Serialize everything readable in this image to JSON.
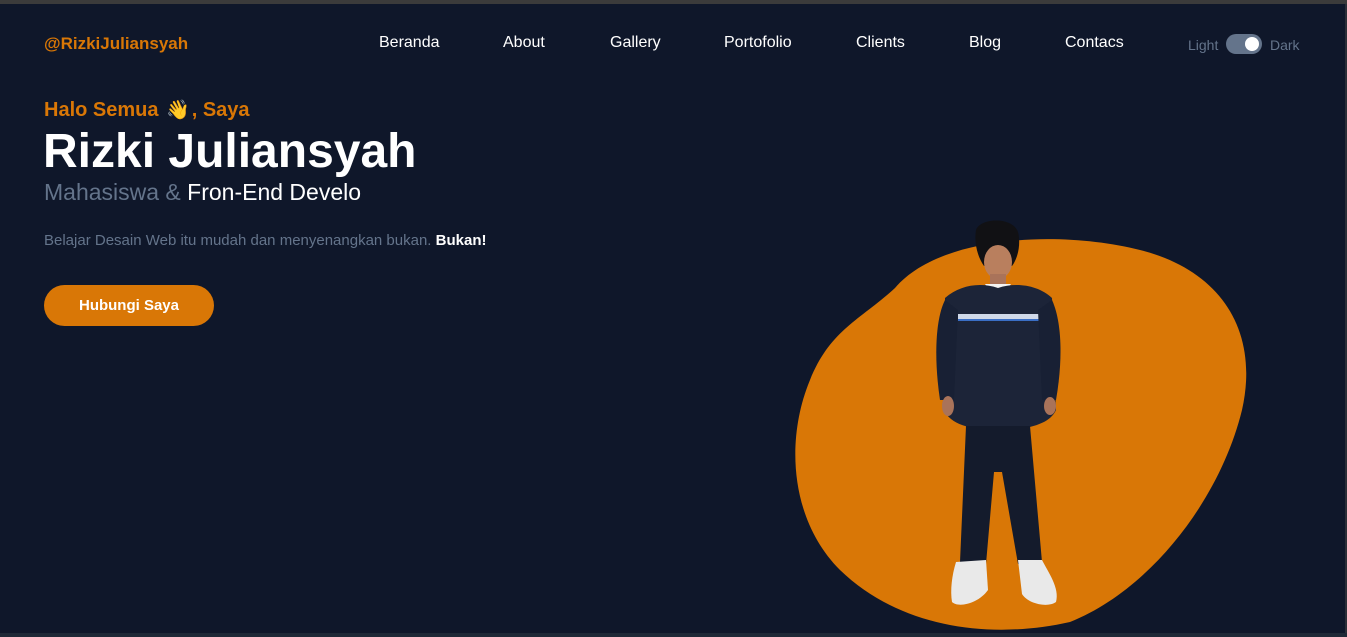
{
  "nav": {
    "brand": "@RizkiJuliansyah",
    "items": [
      {
        "label": "Beranda"
      },
      {
        "label": "About"
      },
      {
        "label": "Gallery"
      },
      {
        "label": "Portofolio"
      },
      {
        "label": "Clients"
      },
      {
        "label": "Blog"
      },
      {
        "label": "Contacs"
      }
    ],
    "theme_toggle": {
      "light_label": "Light",
      "dark_label": "Dark",
      "state": "dark"
    }
  },
  "hero": {
    "greeting_before": "Halo Semua",
    "greeting_emoji": "👋",
    "greeting_after": ", Saya",
    "name": "Rizki Juliansyah",
    "role_muted": "Mahasiswa &",
    "role_highlight": "Fron-End Develo",
    "tagline": "Belajar Desain Web itu mudah dan menyenangkan bukan.",
    "tagline_strong": "Bukan!",
    "cta_label": "Hubungi Saya"
  },
  "colors": {
    "background": "#0f172a",
    "accent": "#d97706",
    "muted": "#64748b",
    "text": "#ffffff"
  }
}
